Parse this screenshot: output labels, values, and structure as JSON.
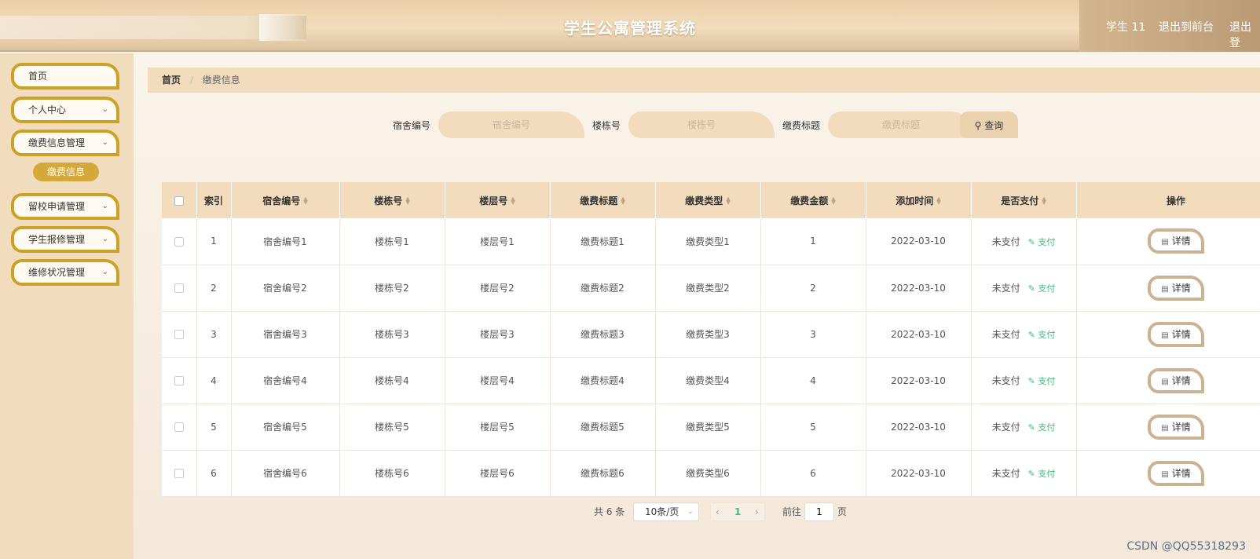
{
  "header": {
    "title": "学生公寓管理系统",
    "user": "学生 11",
    "to_front": "退出到前台",
    "logout": "退出登"
  },
  "sidebar": {
    "items": [
      {
        "label": "首页"
      },
      {
        "label": "个人中心"
      },
      {
        "label": "缴费信息管理"
      },
      {
        "label": "留校申请管理"
      },
      {
        "label": "学生报修管理"
      },
      {
        "label": "维修状况管理"
      }
    ],
    "sub_item": "缴费信息"
  },
  "breadcrumb": {
    "home": "首页",
    "current": "缴费信息"
  },
  "search": {
    "dorm_label": "宿舍编号",
    "dorm_placeholder": "宿舍编号",
    "building_label": "楼栋号",
    "building_placeholder": "楼栋号",
    "title_label": "缴费标题",
    "title_placeholder": "缴费标题",
    "button": "查询"
  },
  "table": {
    "headers": [
      "索引",
      "宿舍编号",
      "楼栋号",
      "楼层号",
      "缴费标题",
      "缴费类型",
      "缴费金额",
      "添加时间",
      "是否支付",
      "操作"
    ],
    "rows": [
      {
        "index": "1",
        "dorm": "宿舍编号1",
        "building": "楼栋号1",
        "floor": "楼层号1",
        "title": "缴费标题1",
        "type": "缴费类型1",
        "amount": "1",
        "date": "2022-03-10",
        "status": "未支付",
        "pay": "支付",
        "detail": "详情"
      },
      {
        "index": "2",
        "dorm": "宿舍编号2",
        "building": "楼栋号2",
        "floor": "楼层号2",
        "title": "缴费标题2",
        "type": "缴费类型2",
        "amount": "2",
        "date": "2022-03-10",
        "status": "未支付",
        "pay": "支付",
        "detail": "详情"
      },
      {
        "index": "3",
        "dorm": "宿舍编号3",
        "building": "楼栋号3",
        "floor": "楼层号3",
        "title": "缴费标题3",
        "type": "缴费类型3",
        "amount": "3",
        "date": "2022-03-10",
        "status": "未支付",
        "pay": "支付",
        "detail": "详情"
      },
      {
        "index": "4",
        "dorm": "宿舍编号4",
        "building": "楼栋号4",
        "floor": "楼层号4",
        "title": "缴费标题4",
        "type": "缴费类型4",
        "amount": "4",
        "date": "2022-03-10",
        "status": "未支付",
        "pay": "支付",
        "detail": "详情"
      },
      {
        "index": "5",
        "dorm": "宿舍编号5",
        "building": "楼栋号5",
        "floor": "楼层号5",
        "title": "缴费标题5",
        "type": "缴费类型5",
        "amount": "5",
        "date": "2022-03-10",
        "status": "未支付",
        "pay": "支付",
        "detail": "详情"
      },
      {
        "index": "6",
        "dorm": "宿舍编号6",
        "building": "楼栋号6",
        "floor": "楼层号6",
        "title": "缴费标题6",
        "type": "缴费类型6",
        "amount": "6",
        "date": "2022-03-10",
        "status": "未支付",
        "pay": "支付",
        "detail": "详情"
      }
    ]
  },
  "pagination": {
    "total": "共 6 条",
    "page_size": "10条/页",
    "current_page": "1",
    "goto_label": "前往",
    "goto_value": "1",
    "page_unit": "页"
  },
  "watermark": "CSDN @QQ55318293",
  "colors": {
    "accent": "#c9a227",
    "header_bg": "#f3dcbd",
    "pay_link": "#3dbd7d"
  }
}
